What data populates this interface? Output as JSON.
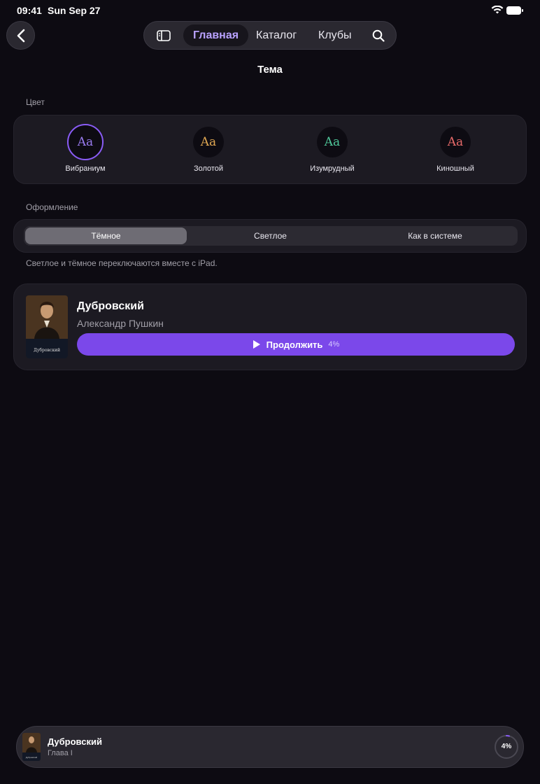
{
  "status_bar": {
    "time": "09:41",
    "date": "Sun Sep 27"
  },
  "nav": {
    "tabs": [
      {
        "label": "Главная",
        "active": true
      },
      {
        "label": "Каталог",
        "active": false
      },
      {
        "label": "Клубы",
        "active": false
      }
    ]
  },
  "page": {
    "title": "Тема"
  },
  "color_section": {
    "label": "Цвет",
    "options": [
      {
        "sample": "Aa",
        "name": "Вибраниум",
        "color": "#9a7cf0",
        "selected": true
      },
      {
        "sample": "Aa",
        "name": "Золотой",
        "color": "#e0a752",
        "selected": false
      },
      {
        "sample": "Aa",
        "name": "Изумрудный",
        "color": "#4fc79a",
        "selected": false
      },
      {
        "sample": "Aa",
        "name": "Киношный",
        "color": "#e86a6a",
        "selected": false
      }
    ]
  },
  "appearance_section": {
    "label": "Оформление",
    "options": [
      "Тёмное",
      "Светлое",
      "Как в системе"
    ],
    "selected": "Тёмное",
    "hint": "Светлое и тёмное переключаются вместе с iPad."
  },
  "book_card": {
    "title": "Дубровский",
    "author": "Александр Пушкин",
    "cover_title": "Дубровский",
    "button_label": "Продолжить",
    "progress_text": "4%",
    "progress": 0.04
  },
  "mini_player": {
    "title": "Дубровский",
    "subtitle": "Глава I",
    "progress_text": "4%",
    "progress": 0.04
  },
  "colors": {
    "accent": "#7b48ea",
    "background": "#0d0b12",
    "card": "#1c1a22"
  }
}
